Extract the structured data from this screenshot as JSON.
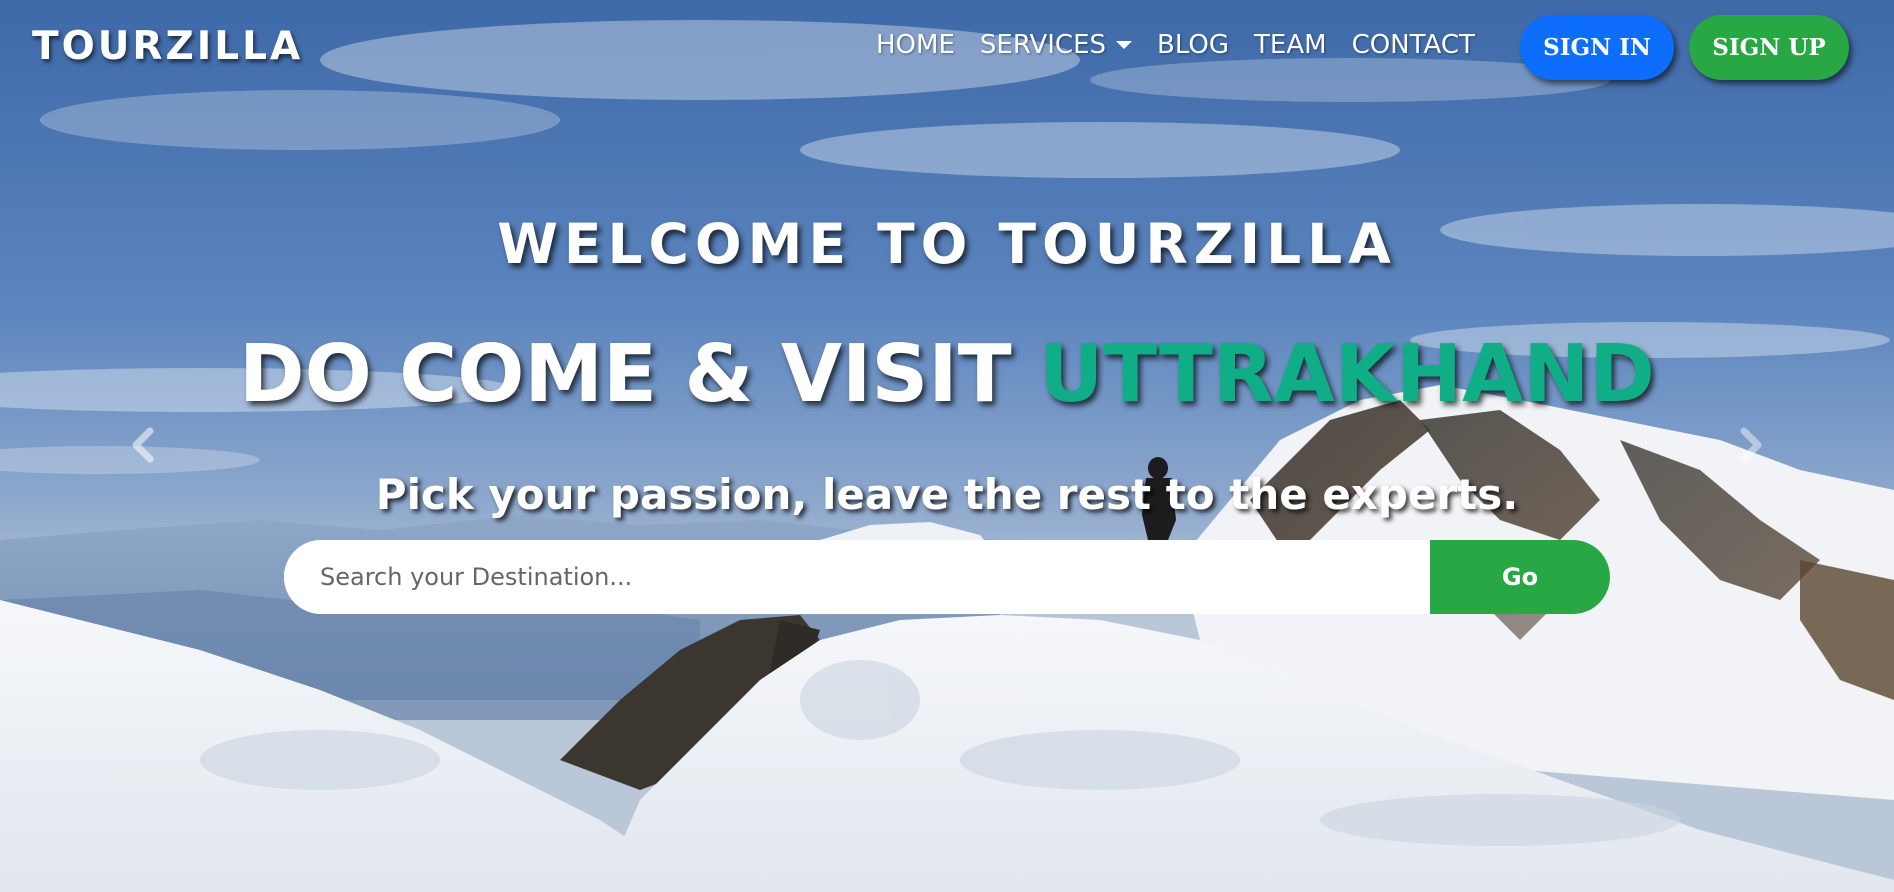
{
  "nav": {
    "brand": "TOURZILLA",
    "links": [
      {
        "label": "HOME"
      },
      {
        "label": "SERVICES"
      },
      {
        "label": "BLOG"
      },
      {
        "label": "TEAM"
      },
      {
        "label": "CONTACT"
      }
    ],
    "sign_in": "SIGN IN",
    "sign_up": "SIGN UP",
    "services_icon": "caret-down-icon"
  },
  "hero": {
    "welcome": "WELCOME TO TOURZILLA",
    "headline_lead": "DO COME & VISIT ",
    "headline_accent": "UTTRAKHAND",
    "tagline": "Pick your passion, leave the rest to the experts.",
    "search_placeholder": "Search your Destination...",
    "search_button": "Go",
    "prev_icon": "chevron-left-icon",
    "next_icon": "chevron-right-icon"
  },
  "colors": {
    "accent_teal": "#0fae87",
    "signin_blue": "#0d6efd",
    "signup_green": "#28a745",
    "go_green": "#28a745"
  }
}
